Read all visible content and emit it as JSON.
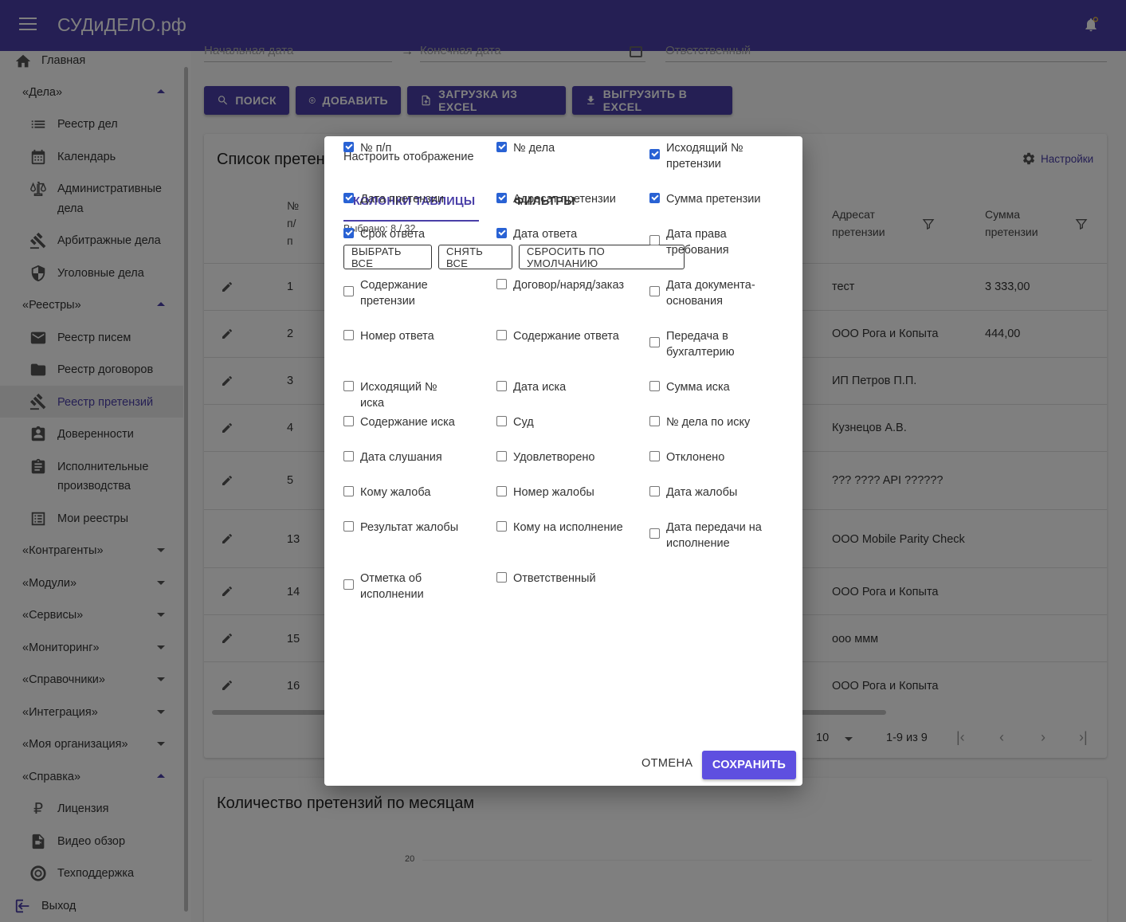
{
  "app": {
    "brand": "СУДиДЕЛО.рф"
  },
  "sidebar": {
    "home": "Главная",
    "groups": {
      "cases": "«Дела»",
      "registries": "«Реестры»",
      "contractors": "«Контрагенты»",
      "modules": "«Модули»",
      "services": "«Сервисы»",
      "monitoring": "«Мониторинг»",
      "references": "«Справочники»",
      "integration": "«Интеграция»",
      "my_org": "«Моя организация»",
      "help": "«Справка»"
    },
    "cases_items": [
      "Реестр дел",
      "Календарь",
      "Административные",
      "дела",
      "Арбитражные дела",
      "Уголовные дела"
    ],
    "registry_items": [
      "Реестр писем",
      "Реестр договоров",
      "Реестр претензий",
      "Доверенности",
      "Исполнительные",
      "производства",
      "Мои реестры"
    ],
    "help_items": [
      "Лицензия",
      "Видео обзор",
      "Техподдержка"
    ],
    "logout": "Выход"
  },
  "filters": {
    "start_date": "Начальная дата",
    "end_date": "Конечная дата",
    "responsible": "Ответственный"
  },
  "toolbar": {
    "search": "ПОИСК",
    "add": "ДОБАВИТЬ",
    "import": "ЗАГРУЗКА ИЗ EXCEL",
    "export": "ВЫГРУЗИТЬ В EXCEL"
  },
  "claims_card": {
    "title": "Список претен",
    "settings": "Настройки",
    "col_num": [
      "№",
      "п/",
      "п"
    ],
    "col_addressee": [
      "Адресат",
      "претензии"
    ],
    "col_sum": [
      "Сумма",
      "претензии"
    ],
    "rows": [
      {
        "num": "1",
        "addressee": "тест",
        "sum": "3 333,00"
      },
      {
        "num": "2",
        "addressee": "ООО Рога и Копыта",
        "sum": "444,00"
      },
      {
        "num": "3",
        "addressee": "ИП Петров П.П.",
        "sum": ""
      },
      {
        "num": "4",
        "addressee": "Кузнецов А.В.",
        "sum": ""
      },
      {
        "num": "5",
        "addressee": "??? ???? API ??????",
        "sum": ""
      },
      {
        "num": "13",
        "addressee": "ООО Mobile Parity Check",
        "sum": ""
      },
      {
        "num": "14",
        "addressee": "ООО Рога и Копыта",
        "sum": ""
      },
      {
        "num": "15",
        "addressee": "ооо ммм",
        "sum": ""
      },
      {
        "num": "16",
        "addressee": "ООО Рога и Копыта",
        "sum": ""
      }
    ],
    "pagination": {
      "per_page": "10",
      "range": "1-9 из 9"
    }
  },
  "chart_card": {
    "title": "Количество претензий по месяцам",
    "tick": "20"
  },
  "dialog": {
    "title": "Настроить отображение",
    "tab_columns": "КОЛОНКИ ТАБЛИЦЫ",
    "tab_filters": "ФИЛЬТРЫ",
    "selected": "Выбрано: 8 / 32",
    "select_all": "ВЫБРАТЬ ВСЕ",
    "deselect_all": "СНЯТЬ ВСЕ",
    "reset": "СБРОСИТЬ ПО УМОЛЧАНИЮ",
    "columns": [
      {
        "label": "№ п/п",
        "checked": true
      },
      {
        "label": "№ дела",
        "checked": true
      },
      {
        "label": "Исходящий № претензии",
        "checked": true
      },
      {
        "label": "Дата претензии",
        "checked": true
      },
      {
        "label": "Адресат претензии",
        "checked": true
      },
      {
        "label": "Сумма претензии",
        "checked": true
      },
      {
        "label": "Срок ответа",
        "checked": true
      },
      {
        "label": "Дата ответа",
        "checked": true
      },
      {
        "label": "Дата права требования",
        "checked": false
      },
      {
        "label": "Содержание претензии",
        "checked": false
      },
      {
        "label": "Договор/наряд/заказ",
        "checked": false
      },
      {
        "label": "Дата документа-основания",
        "checked": false
      },
      {
        "label": "Номер ответа",
        "checked": false
      },
      {
        "label": "Содержание ответа",
        "checked": false
      },
      {
        "label": "Передача в бухгалтерию",
        "checked": false
      },
      {
        "label": "Исходящий № иска",
        "checked": false
      },
      {
        "label": "Дата иска",
        "checked": false
      },
      {
        "label": "Сумма иска",
        "checked": false
      },
      {
        "label": "Содержание иска",
        "checked": false
      },
      {
        "label": "Суд",
        "checked": false
      },
      {
        "label": "№ дела по иску",
        "checked": false
      },
      {
        "label": "Дата слушания",
        "checked": false
      },
      {
        "label": "Удовлетворено",
        "checked": false
      },
      {
        "label": "Отклонено",
        "checked": false
      },
      {
        "label": "Кому жалоба",
        "checked": false
      },
      {
        "label": "Номер жалобы",
        "checked": false
      },
      {
        "label": "Дата жалобы",
        "checked": false
      },
      {
        "label": "Результат жалобы",
        "checked": false
      },
      {
        "label": "Кому на исполнение",
        "checked": false
      },
      {
        "label": "Дата передачи на исполнение",
        "checked": false
      },
      {
        "label": "Отметка об исполнении",
        "checked": false
      },
      {
        "label": "Ответственный",
        "checked": false
      }
    ],
    "cancel": "ОТМЕНА",
    "save": "СОХРАНИТЬ"
  },
  "colors": {
    "primary": "#4a3fa8",
    "save_button": "#5e4fe0",
    "checkbox": "#2962d4"
  }
}
